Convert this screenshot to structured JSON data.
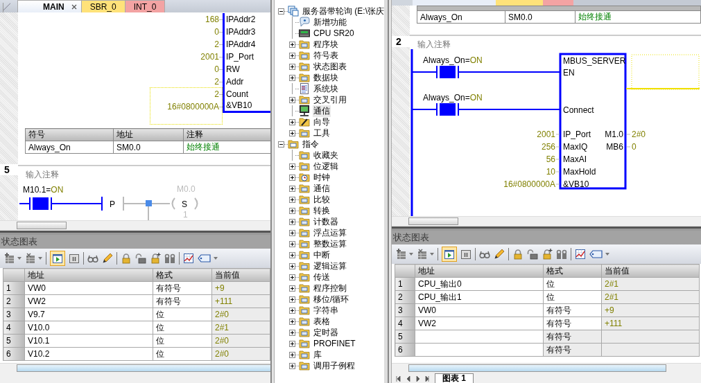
{
  "panels": [
    {
      "editor": {
        "kind": "main_block",
        "tabs": [
          {
            "label": "MAIN",
            "selected": true,
            "closable": true
          },
          {
            "label": "SBR_0",
            "selected": false,
            "color": "#ffe27a"
          },
          {
            "label": "INT_0",
            "selected": false,
            "color": "#f3a3a3"
          }
        ],
        "block_inputs": [
          {
            "value": "168",
            "pin": "IPAddr2"
          },
          {
            "value": "0",
            "pin": "IPAddr3"
          },
          {
            "value": "2",
            "pin": "IPAddr4"
          },
          {
            "value": "2001",
            "pin": "IP_Port"
          },
          {
            "value": "0",
            "pin": "RW"
          },
          {
            "value": "2",
            "pin": "Addr"
          },
          {
            "value": "2",
            "pin": "Count"
          },
          {
            "value": "16#0800000A",
            "pin": "&VB10"
          }
        ],
        "symbol_table": {
          "columns": [
            "符号",
            "地址",
            "注释"
          ],
          "rows": [
            {
              "symbol": "Always_On",
              "address": "SM0.0",
              "comment": "始终接通"
            }
          ]
        },
        "network": {
          "number": "5",
          "comment": "输入注释",
          "contacts": [
            {
              "operand": "M10.1=",
              "state": "ON",
              "energized": true
            }
          ],
          "edge": "P",
          "coil": {
            "operand": "M0.0",
            "type": "S",
            "count": "1",
            "energized": false
          }
        }
      },
      "status_chart": {
        "title": "状态图表",
        "monitoring": true,
        "columns": [
          "地址",
          "格式",
          "当前值"
        ],
        "rows": [
          {
            "index": "1",
            "address": "VW0",
            "format": "有符号",
            "value": "+9"
          },
          {
            "index": "2",
            "address": "VW2",
            "format": "有符号",
            "value": "+111"
          },
          {
            "index": "3",
            "address": "V9.7",
            "format": "位",
            "value": "2#0"
          },
          {
            "index": "4",
            "address": "V10.0",
            "format": "位",
            "value": "2#1"
          },
          {
            "index": "5",
            "address": "V10.1",
            "format": "位",
            "value": "2#0"
          },
          {
            "index": "6",
            "address": "V10.2",
            "format": "位",
            "value": "2#0"
          }
        ]
      }
    },
    {
      "editor": {
        "kind": "server_box",
        "symbol_table": {
          "rows": [
            {
              "symbol": "Always_On",
              "address": "SM0.0",
              "comment": "始终接通"
            }
          ]
        },
        "network": {
          "number": "2",
          "comment": "输入注释",
          "contacts": [
            {
              "operand": "Always_On=",
              "state": "ON",
              "energized": true,
              "pin": "EN"
            },
            {
              "operand": "Always_On=",
              "state": "ON",
              "energized": true,
              "pin": "Connect"
            }
          ],
          "box": {
            "title": "MBUS_SERVER",
            "inputs": [
              {
                "value": "2001",
                "pin": "IP_Port"
              },
              {
                "value": "256",
                "pin": "MaxIQ"
              },
              {
                "value": "56",
                "pin": "MaxAI"
              },
              {
                "value": "10",
                "pin": "MaxHold"
              },
              {
                "value": "16#0800000A",
                "pin": "&VB10"
              }
            ],
            "outputs": [
              {
                "pin": "M1.0",
                "value": "2#0"
              },
              {
                "pin": "MB6",
                "value": "0"
              }
            ]
          }
        }
      },
      "status_chart": {
        "title": "状态图表",
        "monitoring": true,
        "columns": [
          "地址",
          "格式",
          "当前值"
        ],
        "rows": [
          {
            "index": "1",
            "address": "CPU_输出0",
            "format": "位",
            "value": "2#1"
          },
          {
            "index": "2",
            "address": "CPU_输出1",
            "format": "位",
            "value": "2#1"
          },
          {
            "index": "3",
            "address": "VW0",
            "format": "有符号",
            "value": "+9"
          },
          {
            "index": "4",
            "address": "VW2",
            "format": "有符号",
            "value": "+111"
          },
          {
            "index": "5",
            "format": "有符号"
          },
          {
            "index": "6",
            "format": "有符号"
          }
        ],
        "sheet_tabs": [
          {
            "label": "图表 1",
            "selected": true
          }
        ]
      }
    }
  ],
  "project_tree": [
    {
      "label": "服务器带轮询 (E:\\张庆",
      "kind": "project",
      "expanded": true,
      "selected": false,
      "children": [
        {
          "label": "新增功能",
          "kind": "help",
          "selected": false
        },
        {
          "label": "CPU SR20",
          "kind": "cpu",
          "selected": false
        },
        {
          "label": "程序块",
          "kind": "folder",
          "expanded": false,
          "selected": false
        },
        {
          "label": "符号表",
          "kind": "folder",
          "expanded": false,
          "selected": false
        },
        {
          "label": "状态图表",
          "kind": "folder",
          "expanded": false,
          "selected": false
        },
        {
          "label": "数据块",
          "kind": "folder",
          "expanded": false,
          "selected": false
        },
        {
          "label": "系统块",
          "kind": "document",
          "selected": false
        },
        {
          "label": "交叉引用",
          "kind": "folder",
          "expanded": false,
          "selected": false
        },
        {
          "label": "通信",
          "kind": "monitor",
          "selected": true
        },
        {
          "label": "向导",
          "kind": "wand",
          "expanded": false,
          "selected": false
        },
        {
          "label": "工具",
          "kind": "folder",
          "expanded": false,
          "selected": false
        }
      ]
    },
    {
      "label": "指令",
      "kind": "instructions",
      "expanded": true,
      "selected": false,
      "children": [
        {
          "label": "收藏夹",
          "kind": "folder",
          "selected": false
        },
        {
          "label": "位逻辑",
          "kind": "folder",
          "expanded": false,
          "selected": false
        },
        {
          "label": "时钟",
          "kind": "clock",
          "expanded": false,
          "selected": false
        },
        {
          "label": "通信",
          "kind": "folder",
          "expanded": false,
          "selected": false
        },
        {
          "label": "比较",
          "kind": "folder",
          "expanded": false,
          "selected": false
        },
        {
          "label": "转换",
          "kind": "folder",
          "expanded": false,
          "selected": false
        },
        {
          "label": "计数器",
          "kind": "folder",
          "expanded": false,
          "selected": false
        },
        {
          "label": "浮点运算",
          "kind": "folder",
          "expanded": false,
          "selected": false
        },
        {
          "label": "整数运算",
          "kind": "folder",
          "expanded": false,
          "selected": false
        },
        {
          "label": "中断",
          "kind": "folder",
          "expanded": false,
          "selected": false
        },
        {
          "label": "逻辑运算",
          "kind": "folder",
          "expanded": false,
          "selected": false
        },
        {
          "label": "传送",
          "kind": "folder",
          "expanded": false,
          "selected": false
        },
        {
          "label": "程序控制",
          "kind": "folder",
          "expanded": false,
          "selected": false
        },
        {
          "label": "移位/循环",
          "kind": "folder",
          "expanded": false,
          "selected": false
        },
        {
          "label": "字符串",
          "kind": "folder",
          "expanded": false,
          "selected": false
        },
        {
          "label": "表格",
          "kind": "folder",
          "expanded": false,
          "selected": false
        },
        {
          "label": "定时器",
          "kind": "folder",
          "expanded": false,
          "selected": false
        },
        {
          "label": "PROFINET",
          "kind": "folder",
          "expanded": false,
          "selected": false
        },
        {
          "label": "库",
          "kind": "folder",
          "expanded": false,
          "selected": false
        },
        {
          "label": "调用子例程",
          "kind": "folder",
          "expanded": false,
          "selected": false
        }
      ]
    }
  ]
}
